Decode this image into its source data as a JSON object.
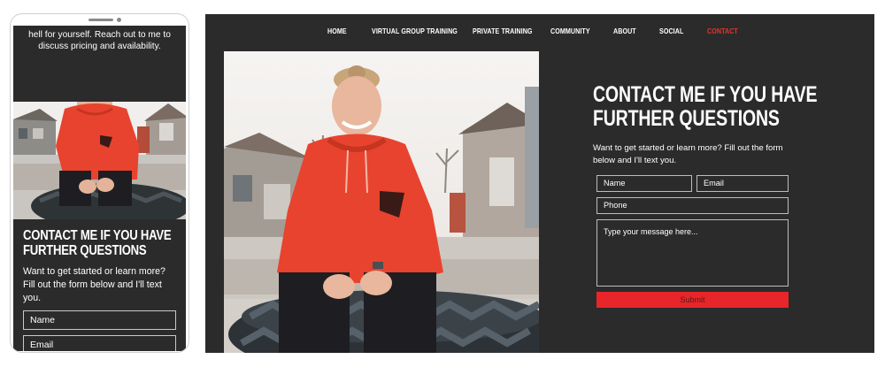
{
  "mobile": {
    "top_text": "hell for yourself. Reach out to me to discuss pricing and availability.",
    "contact": {
      "heading": "CONTACT ME IF YOU HAVE FURTHER QUESTIONS",
      "description": "Want to get started or learn more? Fill out the form below and I'll text you.",
      "name_placeholder": "Name",
      "email_placeholder": "Email"
    }
  },
  "desktop": {
    "nav": [
      {
        "label": "HOME"
      },
      {
        "label": "VIRTUAL GROUP TRAINING"
      },
      {
        "label": "PRIVATE TRAINING"
      },
      {
        "label": "COMMUNITY"
      },
      {
        "label": "ABOUT"
      },
      {
        "label": "SOCIAL"
      },
      {
        "label": "CONTACT"
      }
    ],
    "contact": {
      "heading": "CONTACT ME IF YOU HAVE FURTHER QUESTIONS",
      "description": "Want to get started or learn more? Fill out the form below and I'll text you.",
      "name_placeholder": "Name",
      "email_placeholder": "Email",
      "phone_placeholder": "Phone",
      "message_placeholder": "Type your message here...",
      "submit_label": "Submit"
    }
  },
  "colors": {
    "background": "#2b2b2b",
    "accent": "#e8352a",
    "hoodie": "#e8432e"
  }
}
